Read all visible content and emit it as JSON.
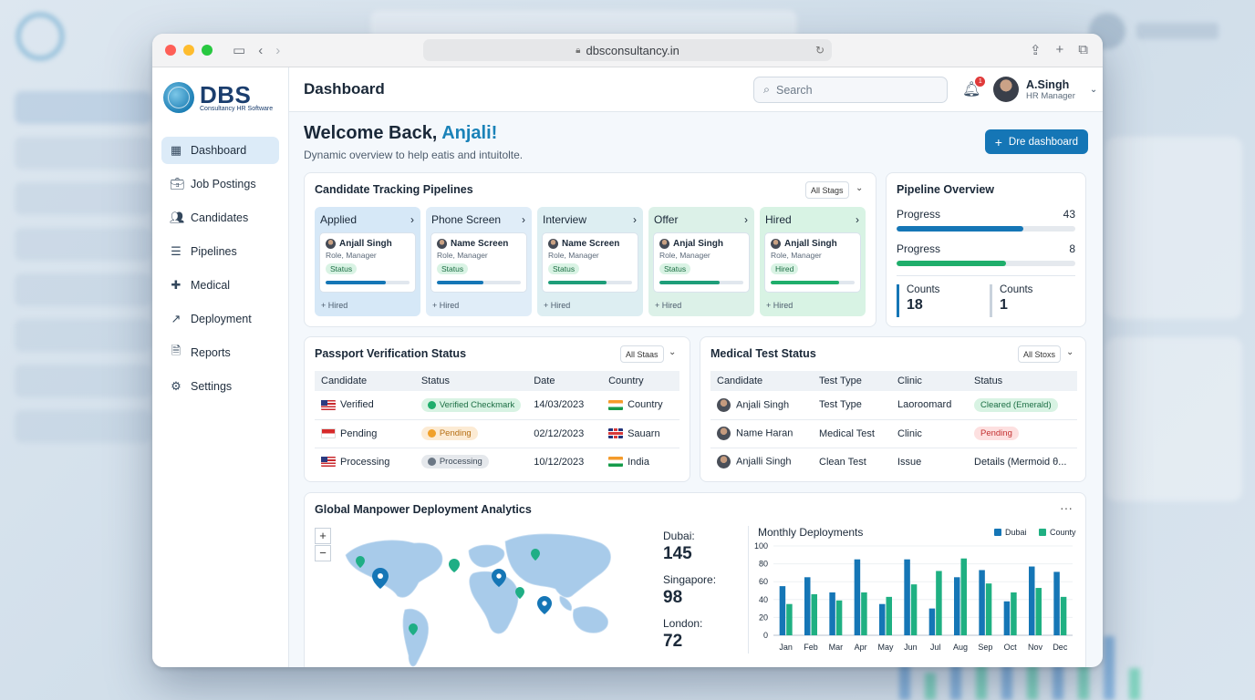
{
  "browser": {
    "url": "dbsconsultancy.in"
  },
  "brand": {
    "name": "DBS",
    "tagline": "Consultancy HR Software"
  },
  "sidebar": {
    "items": [
      {
        "label": "Dashboard",
        "icon": "grid-icon"
      },
      {
        "label": "Job Postings",
        "icon": "briefcase-icon"
      },
      {
        "label": "Candidates",
        "icon": "users-icon"
      },
      {
        "label": "Pipelines",
        "icon": "list-icon"
      },
      {
        "label": "Medical",
        "icon": "medical-cross-icon"
      },
      {
        "label": "Deployment",
        "icon": "arrow-up-right-icon"
      },
      {
        "label": "Reports",
        "icon": "document-icon"
      },
      {
        "label": "Settings",
        "icon": "gear-icon"
      }
    ]
  },
  "header": {
    "title": "Dashboard",
    "search_placeholder": "Search",
    "notifications": "1",
    "user_name": "A.Singh",
    "user_role": "HR Manager"
  },
  "welcome": {
    "prefix": "Welcome Back,",
    "name": "Anjali!",
    "subtitle": "Dynamic overview to help eatis and intuitolte.",
    "cta": "Dre dashboard"
  },
  "pipelines": {
    "title": "Candidate Tracking Pipelines",
    "filter": "All Stags",
    "stages": [
      {
        "name": "Applied",
        "bg": "#d6e8f7",
        "candidate": "Anjall Singh",
        "role": "Role, Manager",
        "status": "Status",
        "progress": 0.72,
        "bar": "#1576b6",
        "footer": "+ Hired"
      },
      {
        "name": "Phone Screen",
        "bg": "#e0edf8",
        "candidate": "Name Screen",
        "role": "Role, Manager",
        "status": "Status",
        "progress": 0.55,
        "bar": "#1576b6",
        "footer": "+ Hired"
      },
      {
        "name": "Interview",
        "bg": "#ddeef2",
        "candidate": "Name Screen",
        "role": "Role, Manager",
        "status": "Status",
        "progress": 0.7,
        "bar": "#1e9e79",
        "footer": "+ Hired"
      },
      {
        "name": "Offer",
        "bg": "#dcf1e8",
        "candidate": "Anjal Singh",
        "role": "Role, Manager",
        "status": "Status",
        "progress": 0.72,
        "bar": "#1e9e79",
        "footer": "+ Hired"
      },
      {
        "name": "Hired",
        "bg": "#d8f3e4",
        "candidate": "Anjall Singh",
        "role": "Role, Manager",
        "status": "Hired",
        "progress": 0.82,
        "bar": "#1fae6b",
        "footer": "+ Hired"
      }
    ]
  },
  "overview": {
    "title": "Pipeline Overview",
    "rows": [
      {
        "label": "Progress",
        "value": "43",
        "fill": 0.71,
        "color": "#1576b6"
      },
      {
        "label": "Progress",
        "value": "8",
        "fill": 0.61,
        "color": "#1fae6b"
      }
    ],
    "counts": [
      {
        "label": "Counts",
        "value": "18"
      },
      {
        "label": "Counts",
        "value": "1"
      }
    ]
  },
  "passport": {
    "title": "Passport Verification Status",
    "filter": "All Staas",
    "columns": [
      "Candidate",
      "Status",
      "Date",
      "Country"
    ],
    "rows": [
      {
        "candidate": "Verified",
        "flag": "us",
        "status": "Verified Checkmark",
        "pill": "green",
        "dot": "#1fae6b",
        "date": "14/03/2023",
        "country": "Country",
        "cflag": "in"
      },
      {
        "candidate": "Pending",
        "flag": "id",
        "status": "Pending",
        "pill": "orange",
        "dot": "#f0a02a",
        "date": "02/12/2023",
        "country": "Sauarn",
        "cflag": "uk"
      },
      {
        "candidate": "Processing",
        "flag": "us",
        "status": "Processing",
        "pill": "gray",
        "dot": "#6b7785",
        "date": "10/12/2023",
        "country": "India",
        "cflag": "in"
      }
    ]
  },
  "medical": {
    "title": "Medical Test Status",
    "filter": "All Stoxs",
    "columns": [
      "Candidate",
      "Test Type",
      "Clinic",
      "Status"
    ],
    "rows": [
      {
        "candidate": "Anjali Singh",
        "test": "Test Type",
        "clinic": "Laoroomard",
        "status": "Cleared (Emerald)",
        "pill": "green"
      },
      {
        "candidate": "Name Haran",
        "test": "Medical Test",
        "clinic": "Clinic",
        "status": "Pending",
        "pill": "red"
      },
      {
        "candidate": "Anjalli Singh",
        "test": "Clean Test",
        "clinic": "Issue",
        "status": "Details (Mermoid θ...",
        "pill": "none"
      }
    ]
  },
  "analytics": {
    "title": "Global Manpower Deployment Analytics",
    "zoom_in": "+",
    "zoom_out": "−",
    "cities": [
      {
        "label": "Dubai:",
        "value": "145"
      },
      {
        "label": "Singapore:",
        "value": "98"
      },
      {
        "label": "London:",
        "value": "72"
      }
    ]
  },
  "chart_data": {
    "type": "bar",
    "title": "Monthly Deployments",
    "categories": [
      "Jan",
      "Feb",
      "Mar",
      "Apr",
      "May",
      "Jun",
      "Jul",
      "Aug",
      "Sep",
      "Oct",
      "Nov",
      "Dec"
    ],
    "series": [
      {
        "name": "Dubai",
        "color": "#1576b6",
        "values": [
          55,
          65,
          48,
          85,
          35,
          85,
          30,
          65,
          73,
          38,
          77,
          71
        ]
      },
      {
        "name": "County",
        "color": "#1fb082",
        "values": [
          35,
          46,
          39,
          48,
          43,
          57,
          72,
          86,
          58,
          48,
          53,
          43
        ]
      }
    ],
    "ylim": [
      0,
      100
    ],
    "yticks": [
      0,
      20,
      40,
      60,
      80,
      100
    ],
    "legend": "top-right",
    "grid": true
  }
}
